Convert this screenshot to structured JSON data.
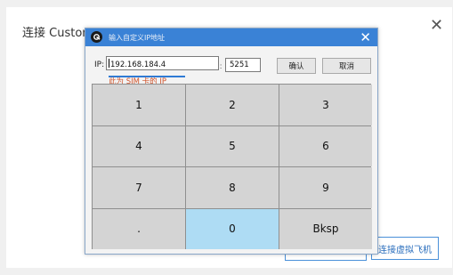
{
  "background_dialog": {
    "title": "连接 Custom",
    "close_icon": "close-icon",
    "simulator_button_label": "连接虚拟飞机"
  },
  "modal": {
    "title": "输入自定义IP地址",
    "logo_icon": "app-logo-icon",
    "close_icon": "close-icon",
    "titlebar_color": "#3a82d6",
    "ip_label": "IP:",
    "ip_value": "192.168.184.4",
    "port_separator": ":",
    "port_value": "5251",
    "confirm_label": "确认",
    "cancel_label": "取消",
    "hint": "此为 SIM 卡的 IP",
    "hint_color": "#d0532a"
  },
  "keypad": {
    "keys": [
      "1",
      "2",
      "3",
      "4",
      "5",
      "6",
      "7",
      "8",
      "9",
      ".",
      "0",
      "Bksp"
    ],
    "active_key": "0",
    "active_color": "#aedcf4"
  }
}
